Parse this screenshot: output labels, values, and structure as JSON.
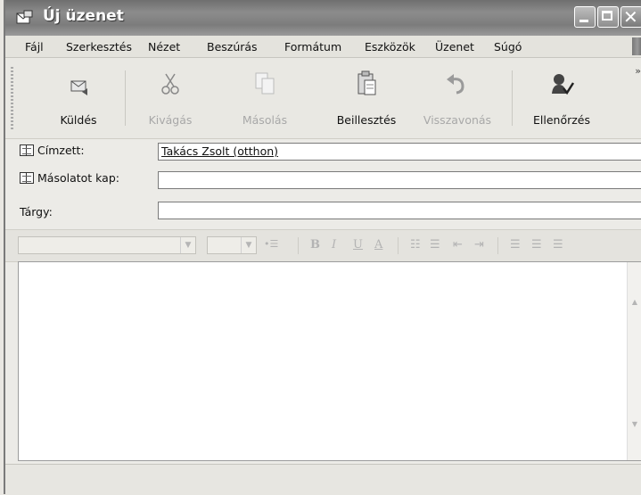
{
  "window": {
    "title": "Új üzenet"
  },
  "menu": [
    "Fájl",
    "Szerkesztés",
    "Nézet",
    "Beszúrás",
    "Formátum",
    "Eszközök",
    "Üzenet",
    "Súgó"
  ],
  "toolbar": {
    "send": "Küldés",
    "cut": "Kivágás",
    "copy": "Másolás",
    "paste": "Beillesztés",
    "undo": "Visszavonás",
    "check": "Ellenőrzés"
  },
  "fields": {
    "to_label": "Címzett:",
    "to_value": "Takács Zsolt (otthon)",
    "cc_label": "Másolatot kap:",
    "cc_value": "",
    "subject_label": "Tárgy:",
    "subject_value": ""
  },
  "format": {
    "bold": "B",
    "italic": "I",
    "underline": "U",
    "color": "A"
  },
  "icons": [
    "envelope-icon",
    "send-icon",
    "scissors-icon",
    "copy-icon",
    "paste-icon",
    "undo-icon",
    "spellcheck-icon",
    "address-book-icon"
  ]
}
